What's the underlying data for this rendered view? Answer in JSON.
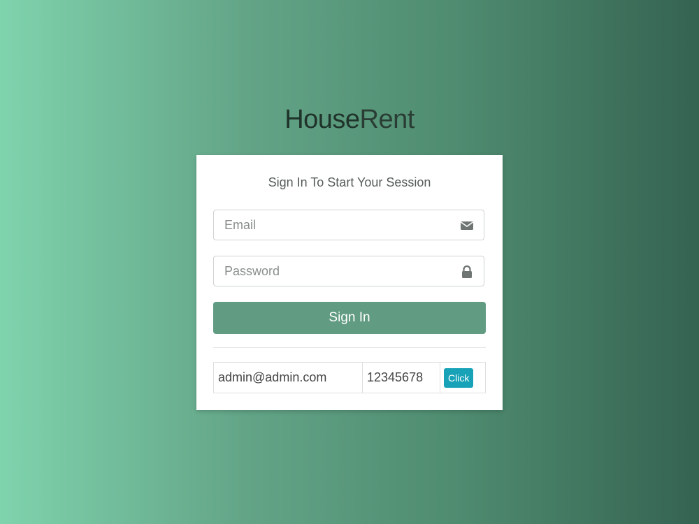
{
  "brand": {
    "bold": "House",
    "light": "Rent"
  },
  "login": {
    "subtitle": "Sign In To Start Your Session",
    "email_placeholder": "Email",
    "password_placeholder": "Password",
    "signin_label": "Sign In"
  },
  "demo_credentials": {
    "email": "admin@admin.com",
    "password": "12345678",
    "button_label": "Click"
  },
  "icons": {
    "email": "envelope-icon",
    "password": "lock-icon"
  },
  "colors": {
    "primary_button": "#619b82",
    "click_button": "#17a2b8"
  }
}
